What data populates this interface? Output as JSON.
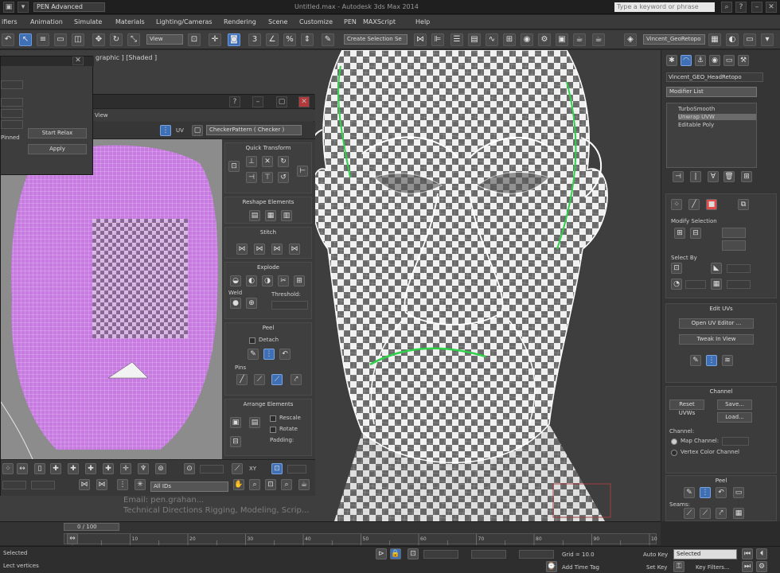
{
  "titlebar": {
    "workspace": "PEN Advanced",
    "title": "Untitled.max - Autodesk 3ds Max 2014",
    "search_placeholder": "Type a keyword or phrase"
  },
  "menu": [
    "ifiers",
    "Animation",
    "Simulate",
    "Materials",
    "Lighting/Cameras",
    "Rendering",
    "Scene",
    "Customize",
    "PEN",
    "MAXScript",
    "Help"
  ],
  "toolbar": {
    "select_filter": "View",
    "selection_set": "Create Selection Se",
    "object_name": "Vincent_GeoRetopo"
  },
  "viewport": {
    "label": "graphic ] [Shaded ]"
  },
  "relax": {
    "start_button": "Start Relax",
    "apply_button": "Apply",
    "pinned_label": "Pinned"
  },
  "uv_editor": {
    "menu_view": "View",
    "uv_label": "UV",
    "pattern_dropdown": "CheckerPattern  ( Checker )",
    "sections": {
      "quick_transform": "Quick Transform",
      "reshape": "Reshape Elements",
      "stitch": "Stitch",
      "explode": "Explode",
      "weld": "Weld",
      "threshold_label": "Threshold:",
      "peel": "Peel",
      "detach": "Detach",
      "pins": "Pins",
      "arrange": "Arrange Elements",
      "rescale": "Rescale",
      "rotate": "Rotate",
      "padding": "Padding:"
    },
    "xy_label": "XY",
    "all_ids": "All IDs"
  },
  "watermark": {
    "line1": "Email: pen.grahan...",
    "line2": "Technical Directions Rigging, Modeling, Scrip..."
  },
  "command_panel": {
    "object_name": "Vincent_GEO_HeadRetopo",
    "modifier_list": "Modifier List",
    "stack": [
      "TurboSmooth",
      "Unwrap UVW",
      "Editable Poly"
    ],
    "modify_selection": "Modify Selection",
    "select_by": "Select By",
    "edit_uvs": "Edit UVs",
    "open_uv_editor": "Open UV Editor ...",
    "tweak_in_view": "Tweak In View",
    "channel": "Channel",
    "reset_uvws": "Reset UVWs",
    "save": "Save...",
    "load": "Load...",
    "channel_label": "Channel:",
    "map_channel": "Map Channel:",
    "vertex_color": "Vertex Color Channel",
    "peel": "Peel",
    "seams": "Seams:"
  },
  "timeline": {
    "frame": "0 / 100",
    "ticks": [
      "0",
      "10",
      "20",
      "30",
      "40",
      "50",
      "60",
      "70",
      "80",
      "90",
      "100"
    ]
  },
  "status": {
    "selected": "Selected",
    "hint": "Lect vertices",
    "grid": "Grid = 10.0",
    "add_time_tag": "Add Time Tag",
    "auto_key": "Auto Key",
    "set_key": "Set Key",
    "key_filters": "Key Filters...",
    "selected_dropdown": "Selected"
  },
  "colors": {
    "accent_blue": "#3f6fb5",
    "uv_mesh": "#c77ae0",
    "seam_green": "#2fd04a"
  }
}
